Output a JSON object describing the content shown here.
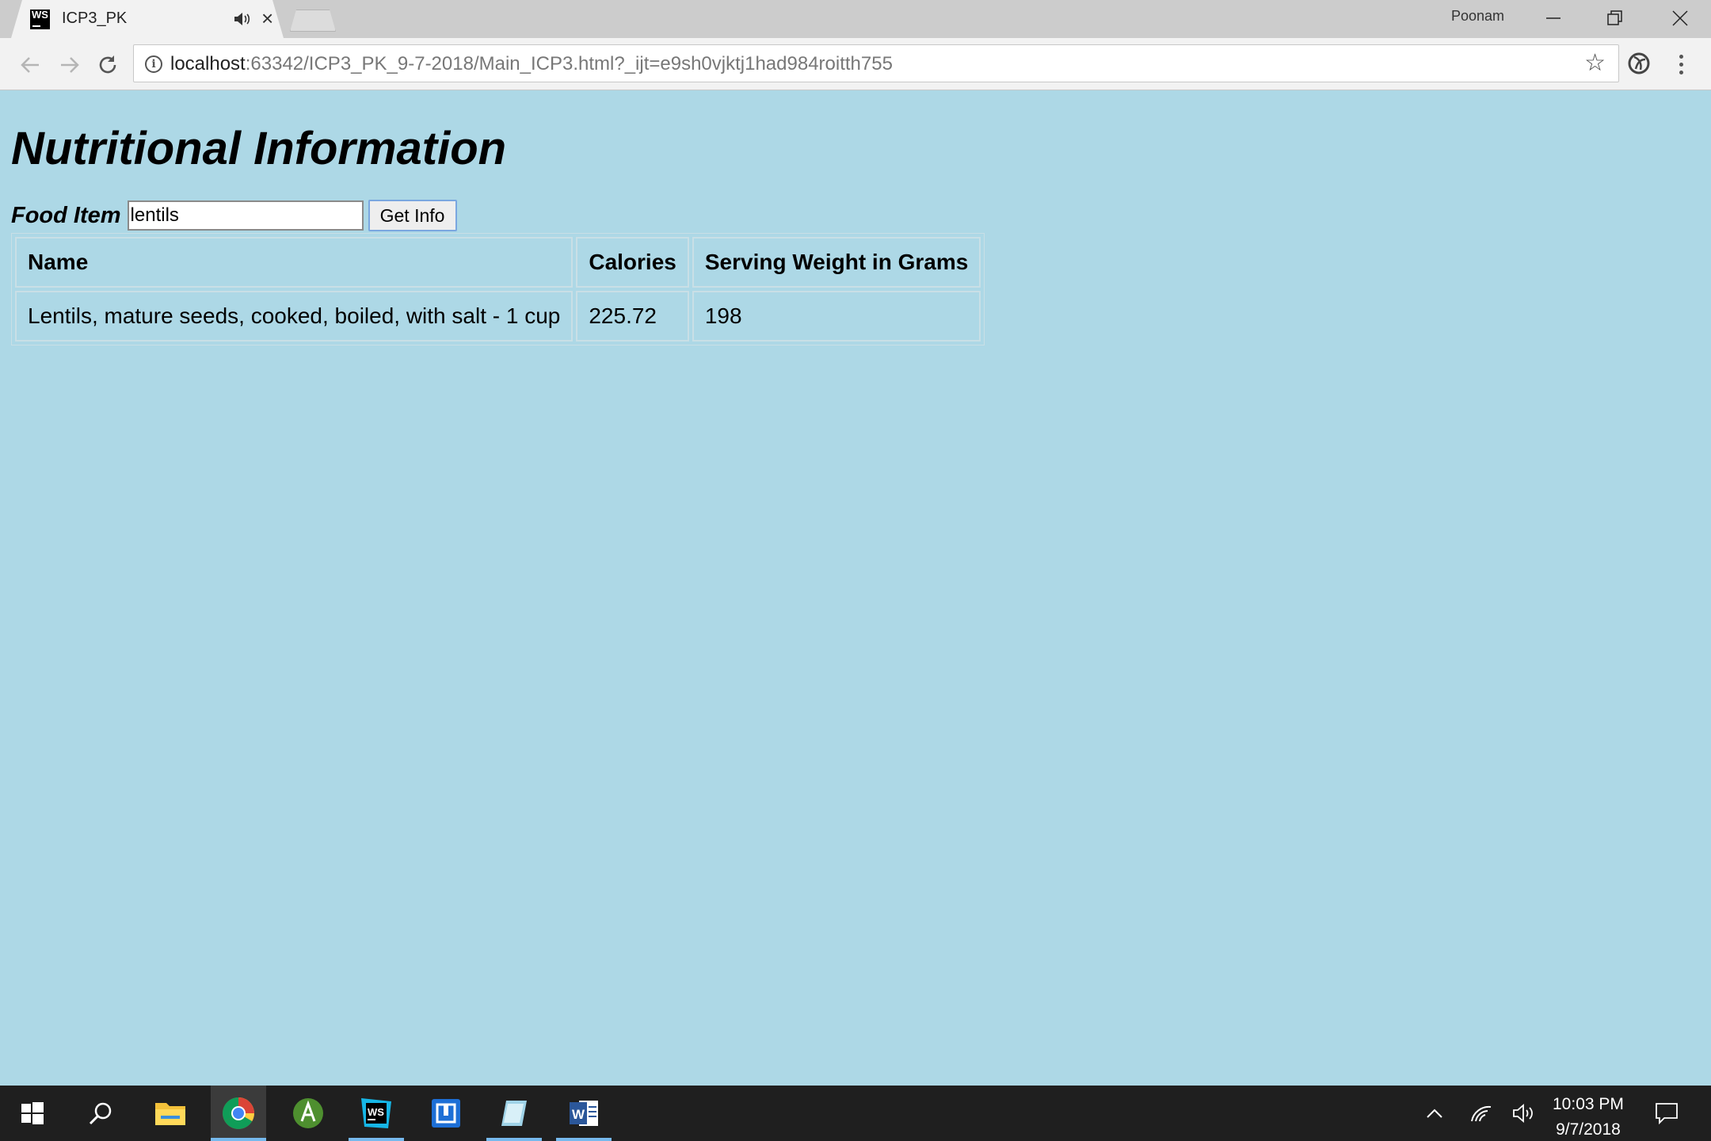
{
  "browser": {
    "tab_title": "ICP3_PK",
    "tab_favicon_text": "WS",
    "profile_name": "Poonam",
    "url_host": "localhost",
    "url_rest": ":63342/ICP3_PK_9-7-2018/Main_ICP3.html?_ijt=e9sh0vjktj1had984roitth755"
  },
  "page": {
    "title": "Nutritional Information",
    "food_label": "Food Item",
    "food_input_value": "lentils",
    "button_label": "Get Info",
    "table": {
      "headers": [
        "Name",
        "Calories",
        "Serving Weight in Grams"
      ],
      "rows": [
        [
          "Lentils, mature seeds, cooked, boiled, with salt - 1 cup",
          "225.72",
          "198"
        ]
      ]
    },
    "background_color": "#add8e6"
  },
  "taskbar": {
    "apps": [
      "windows-start-icon",
      "search-icon",
      "file-explorer-icon",
      "chrome-icon",
      "android-studio-icon",
      "webstorm-icon",
      "virtualbox-icon",
      "notepad-icon",
      "word-icon"
    ],
    "time": "10:03 PM",
    "date": "9/7/2018"
  }
}
